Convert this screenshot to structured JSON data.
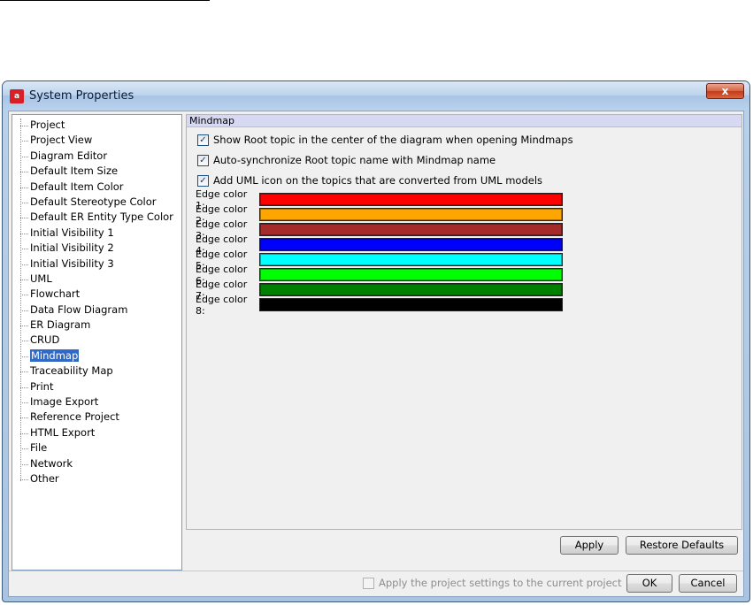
{
  "window": {
    "title": "System Properties",
    "app_icon_text": "a",
    "close_label": "x"
  },
  "tree": {
    "items": [
      {
        "label": "Project"
      },
      {
        "label": "Project View"
      },
      {
        "label": "Diagram Editor"
      },
      {
        "label": "Default Item Size"
      },
      {
        "label": "Default Item Color"
      },
      {
        "label": "Default Stereotype Color"
      },
      {
        "label": "Default ER Entity Type Color"
      },
      {
        "label": "Initial Visibility 1"
      },
      {
        "label": "Initial Visibility 2"
      },
      {
        "label": "Initial Visibility 3"
      },
      {
        "label": "UML"
      },
      {
        "label": "Flowchart"
      },
      {
        "label": "Data Flow Diagram"
      },
      {
        "label": "ER Diagram"
      },
      {
        "label": "CRUD"
      },
      {
        "label": "Mindmap"
      },
      {
        "label": "Traceability Map"
      },
      {
        "label": "Print"
      },
      {
        "label": "Image Export"
      },
      {
        "label": "Reference Project"
      },
      {
        "label": "HTML Export"
      },
      {
        "label": "File"
      },
      {
        "label": "Network"
      },
      {
        "label": "Other"
      }
    ],
    "selected": "Mindmap"
  },
  "panel": {
    "header": "Mindmap",
    "checkboxes": [
      {
        "label": "Show Root topic in the center of the diagram when opening Mindmaps",
        "checked": true
      },
      {
        "label": "Auto-synchronize Root topic name with Mindmap name",
        "checked": true
      },
      {
        "label": "Add UML icon on the topics that are converted from UML models",
        "checked": true
      }
    ],
    "check_mark": "✓",
    "edge_colors": [
      {
        "label": "Edge color 1:",
        "color": "#ff0000"
      },
      {
        "label": "Edge color 2:",
        "color": "#ffa500"
      },
      {
        "label": "Edge color 3:",
        "color": "#a52a2a"
      },
      {
        "label": "Edge color 4:",
        "color": "#0000ff"
      },
      {
        "label": "Edge color 5:",
        "color": "#00ffff"
      },
      {
        "label": "Edge color 6:",
        "color": "#00ff00"
      },
      {
        "label": "Edge color 7:",
        "color": "#008000"
      },
      {
        "label": "Edge color 8:",
        "color": "#000000"
      }
    ]
  },
  "buttons": {
    "apply": "Apply",
    "restore_defaults": "Restore Defaults",
    "ok": "OK",
    "cancel": "Cancel"
  },
  "footer": {
    "apply_project_label": "Apply the project settings to the current project",
    "apply_project_checked": false
  }
}
